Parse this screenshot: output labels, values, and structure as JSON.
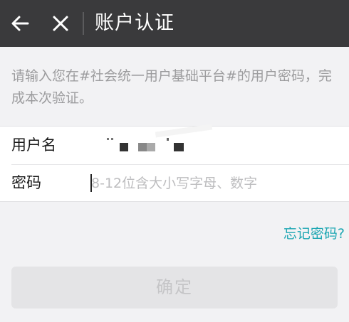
{
  "titlebar": {
    "back_icon": "arrow-left-icon",
    "close_icon": "close-icon",
    "title": "账户认证"
  },
  "hint": "请输入您在#社会统一用户基础平台#的用户密码，完成本次验证。",
  "form": {
    "username": {
      "label": "用户名",
      "value_masked": true
    },
    "password": {
      "label": "密码",
      "placeholder": "8-12位含大小写字母、数字",
      "value": ""
    }
  },
  "forgot_link": "忘记密码?",
  "confirm_button": {
    "label": "确定",
    "enabled": false
  },
  "colors": {
    "titlebar_bg": "#3a3a3c",
    "page_bg": "#f2f2f4",
    "link": "#1ba6b2",
    "button_disabled_bg": "#e4e4e6",
    "button_disabled_text": "#c5c5c7"
  }
}
